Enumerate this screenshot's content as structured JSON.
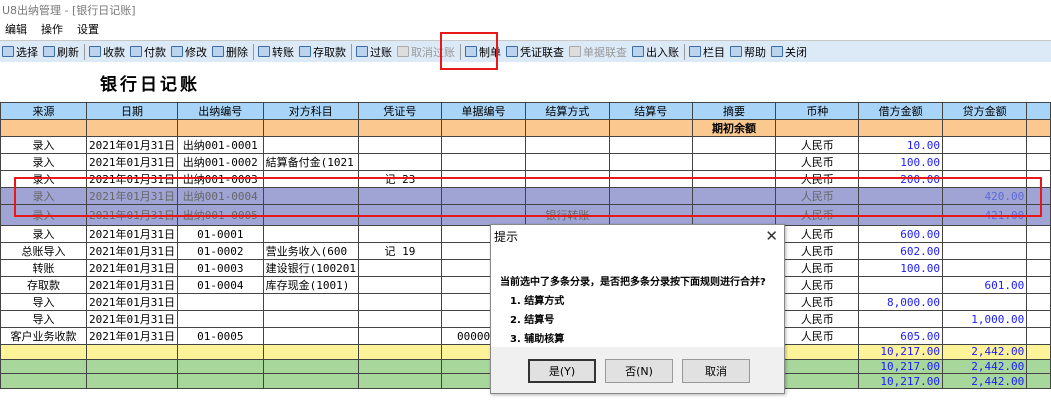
{
  "window": {
    "title": "U8出纳管理 - [银行日记账]"
  },
  "menu": [
    "编辑",
    "操作",
    "设置"
  ],
  "toolbar": [
    {
      "label": "选择",
      "icon": "select-icon",
      "enabled": true
    },
    {
      "label": "刷新",
      "icon": "refresh-icon",
      "enabled": true
    },
    {
      "sep": true
    },
    {
      "label": "收款",
      "icon": "receive-icon",
      "enabled": true
    },
    {
      "label": "付款",
      "icon": "pay-icon",
      "enabled": true
    },
    {
      "label": "修改",
      "icon": "edit-icon",
      "enabled": true
    },
    {
      "label": "删除",
      "icon": "delete-icon",
      "enabled": true
    },
    {
      "sep": true
    },
    {
      "label": "转账",
      "icon": "transfer-icon",
      "enabled": true
    },
    {
      "label": "存取款",
      "icon": "deposit-icon",
      "enabled": true
    },
    {
      "sep": true
    },
    {
      "label": "过账",
      "icon": "post-icon",
      "enabled": true
    },
    {
      "label": "取消过账",
      "icon": "unpost-icon",
      "enabled": false
    },
    {
      "sep": true
    },
    {
      "label": "制单",
      "icon": "voucher-make-icon",
      "enabled": true
    },
    {
      "label": "凭证联查",
      "icon": "voucher-query-icon",
      "enabled": true
    },
    {
      "label": "单据联查",
      "icon": "document-query-icon",
      "enabled": false
    },
    {
      "label": "出入账",
      "icon": "in-out-icon",
      "enabled": true
    },
    {
      "sep": true
    },
    {
      "label": "栏目",
      "icon": "columns-icon",
      "enabled": true
    },
    {
      "label": "帮助",
      "icon": "help-icon",
      "enabled": true
    },
    {
      "label": "关闭",
      "icon": "close-icon",
      "enabled": true
    }
  ],
  "page_title": "银行日记账",
  "table": {
    "headers": [
      "来源",
      "日期",
      "出纳编号",
      "对方科目",
      "凭证号",
      "单据编号",
      "结算方式",
      "结算号",
      "摘要",
      "币种",
      "借方金额",
      "贷方金额",
      ""
    ],
    "opening_label": "期初余额",
    "rows": [
      {
        "c": [
          "录入",
          "2021年01月31日",
          "出纳001-0001",
          "",
          "",
          "",
          "",
          "",
          "",
          "人民币",
          "10.00",
          "",
          ""
        ]
      },
      {
        "c": [
          "录入",
          "2021年01月31日",
          "出纳001-0002",
          "結算备付金(1021",
          "",
          "",
          "",
          "",
          "",
          "人民币",
          "100.00",
          "",
          ""
        ]
      },
      {
        "c": [
          "录入",
          "2021年01月31日",
          "出纳001-0003",
          "",
          "记  23",
          "",
          "",
          "",
          "",
          "人民币",
          "200.00",
          "",
          ""
        ]
      },
      {
        "c": [
          "录入",
          "2021年01月31日",
          "出纳001-0004",
          "",
          "",
          "",
          "",
          "",
          "",
          "人民币",
          "",
          "420.00",
          ""
        ],
        "selected": true
      },
      {
        "c": [
          "录入",
          "2021年01月31日",
          "出纳001-0005",
          "",
          "",
          "",
          "银行转账",
          "",
          "",
          "人民币",
          "",
          "421.00",
          ""
        ],
        "selected": true,
        "tall": true
      },
      {
        "c": [
          "录入",
          "2021年01月31日",
          "01-0001",
          "",
          "",
          "",
          "",
          "",
          "",
          "人民币",
          "600.00",
          "",
          ""
        ]
      },
      {
        "c": [
          "总账导入",
          "2021年01月31日",
          "01-0002",
          "营业务收入(600",
          "记  19",
          "",
          "",
          "",
          "",
          "人民币",
          "602.00",
          "",
          ""
        ]
      },
      {
        "c": [
          "转账",
          "2021年01月31日",
          "01-0003",
          "建设银行(100201",
          "",
          "",
          "",
          "",
          "",
          "人民币",
          "100.00",
          "",
          ""
        ]
      },
      {
        "c": [
          "存取款",
          "2021年01月31日",
          "01-0004",
          "库存现金(1001)",
          "",
          "",
          "",
          "",
          "",
          "人民币",
          "",
          "601.00",
          ""
        ]
      },
      {
        "c": [
          "导入",
          "2021年01月31日",
          "",
          "",
          "",
          "",
          "",
          "",
          "",
          "人民币",
          "8,000.00",
          "",
          ""
        ]
      },
      {
        "c": [
          "导入",
          "2021年01月31日",
          "",
          "",
          "",
          "",
          "",
          "",
          "",
          "人民币",
          "",
          "1,000.00",
          ""
        ]
      },
      {
        "c": [
          "客户业务收款",
          "2021年01月31日",
          "01-0005",
          "",
          "",
          "00000000",
          "",
          "",
          "",
          "人民币",
          "605.00",
          "",
          ""
        ]
      }
    ],
    "totals": [
      {
        "debit": "10,217.00",
        "credit": "2,442.00",
        "color": "yellow"
      },
      {
        "debit": "10,217.00",
        "credit": "2,442.00",
        "color": "green"
      },
      {
        "debit": "10,217.00",
        "credit": "2,442.00",
        "color": "green"
      }
    ]
  },
  "dialog": {
    "title": "提示",
    "message": "当前选中了多条分录，是否把多条分录按下面规则进行合并?",
    "items": [
      "1. 结算方式",
      "2. 结算号",
      "3. 辅助核算"
    ],
    "buttons": {
      "yes": "是(Y)",
      "no": "否(N)",
      "cancel": "取消"
    }
  }
}
